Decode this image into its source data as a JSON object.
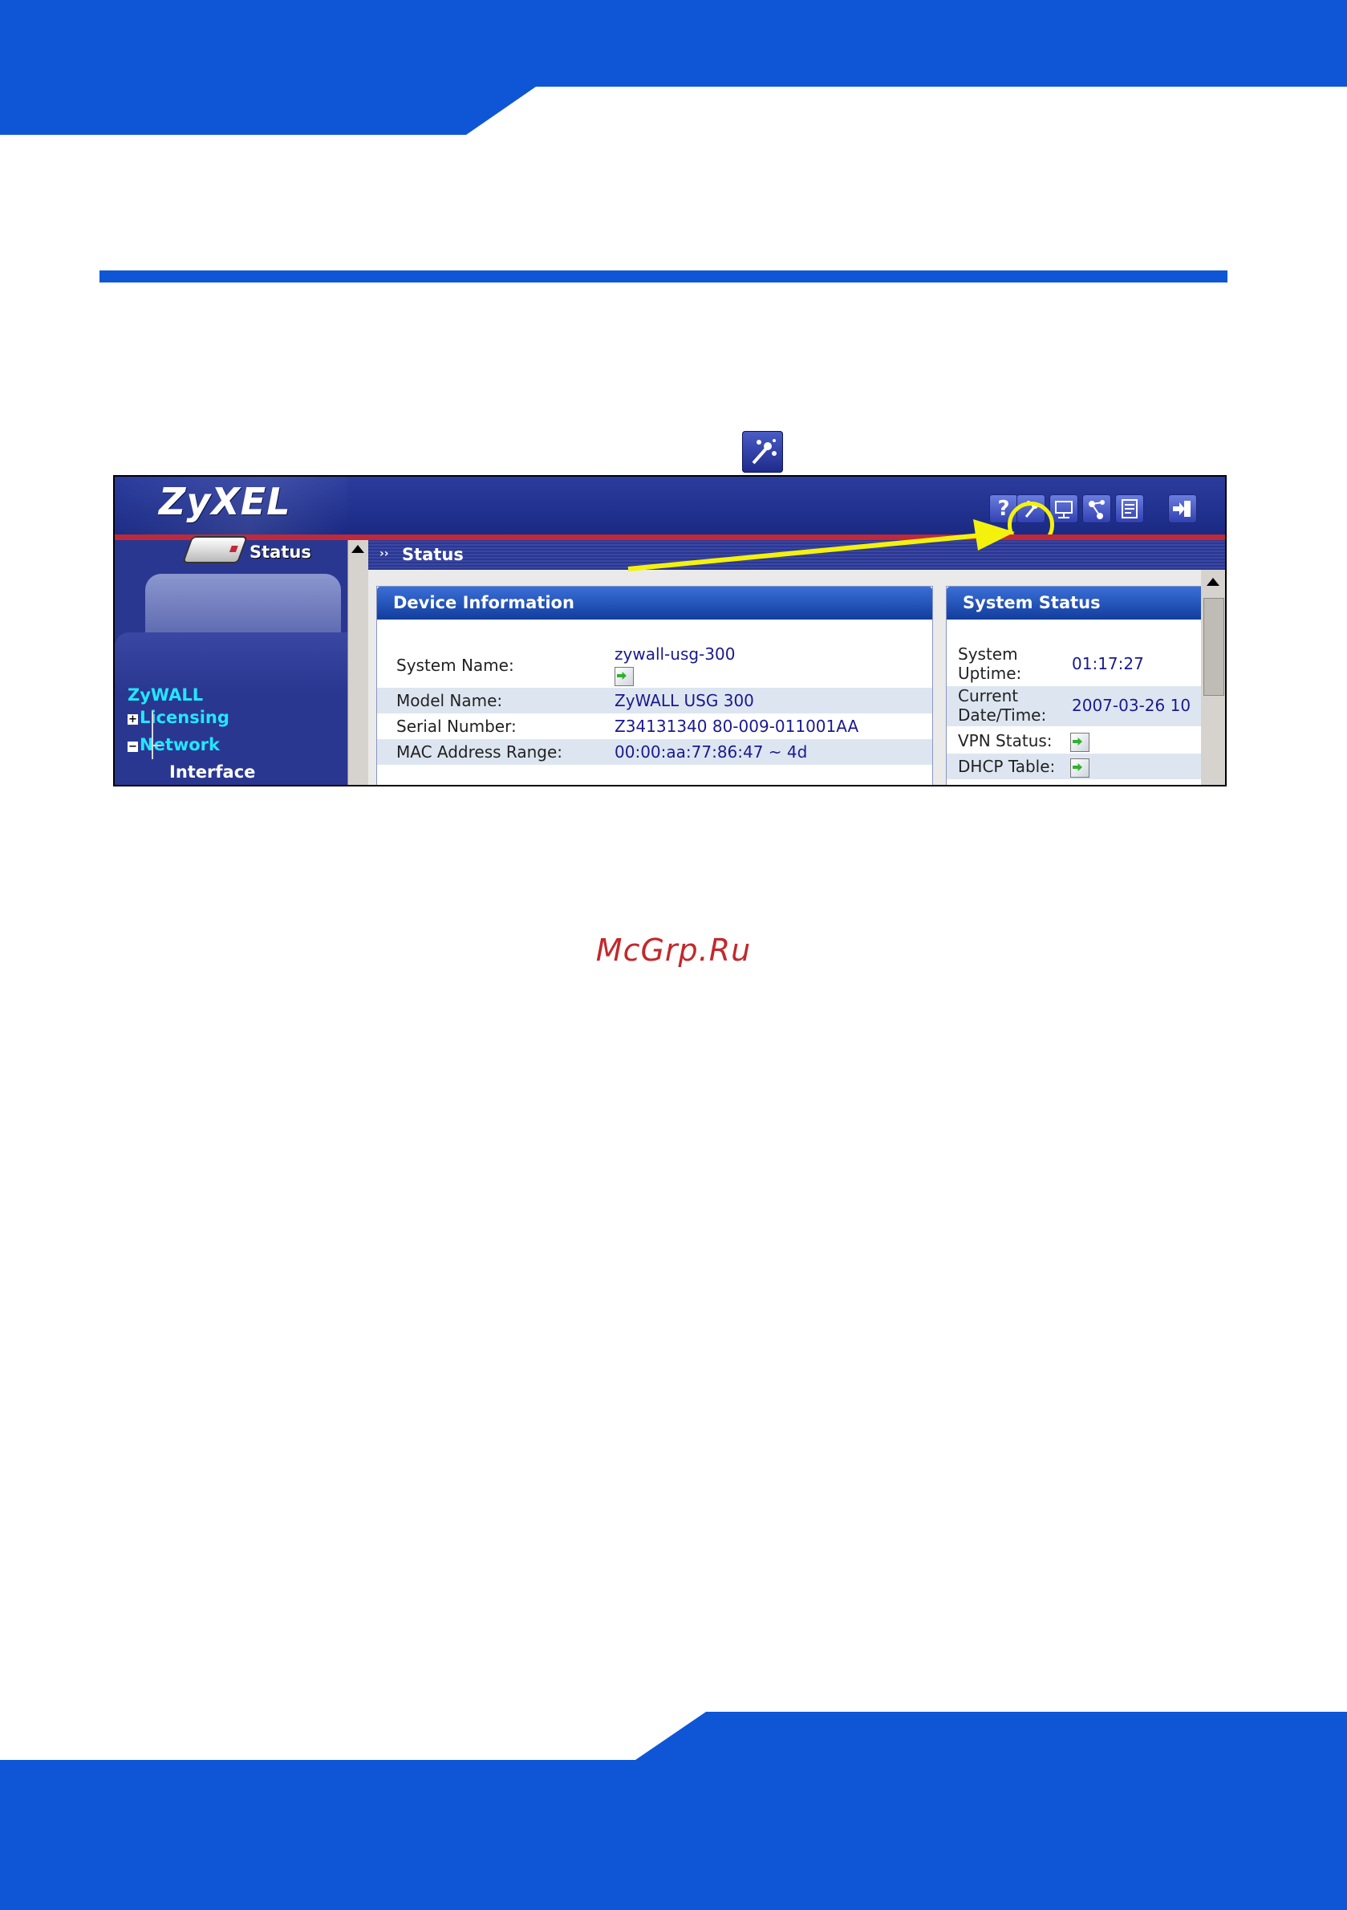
{
  "colors": {
    "page_band": "#0f56d6",
    "ui_header": "#1a2a83",
    "ui_red_line": "#c0293a",
    "highlight": "#f4f20c",
    "watermark": "#c3282c"
  },
  "callout_icon": {
    "icon": "wizard-wand-icon"
  },
  "screenshot": {
    "logo": "ZyXEL",
    "toolbar_icons": [
      "help-icon",
      "wizard-icon",
      "console-icon",
      "network-map-icon",
      "object-reference-icon",
      "logout-icon"
    ],
    "toolbar_help_glyph": "?",
    "sidebar": {
      "tab_label": "Status",
      "tree": {
        "root": "ZyWALL",
        "licensing": "Licensing",
        "network": "Network",
        "interface": "Interface"
      }
    },
    "main": {
      "title": "Status",
      "device_info": {
        "title": "Device Information",
        "rows": [
          {
            "label": "System Name:",
            "value": "zywall-usg-300"
          },
          {
            "label": "Model Name:",
            "value": "ZyWALL USG 300"
          },
          {
            "label": "Serial Number:",
            "value": "Z34131340 80-009-011001AA"
          },
          {
            "label": "MAC Address Range:",
            "value": "00:00:aa:77:86:47 ~ 4d"
          }
        ]
      },
      "system_status": {
        "title": "System Status",
        "rows": [
          {
            "label_1": "System",
            "label_2": "Uptime:",
            "value": "01:17:27"
          },
          {
            "label_1": "Current",
            "label_2": "Date/Time:",
            "value": "2007-03-26 10"
          },
          {
            "label": "VPN Status:"
          },
          {
            "label": "DHCP Table:"
          }
        ]
      }
    }
  },
  "watermark": "McGrp.Ru"
}
